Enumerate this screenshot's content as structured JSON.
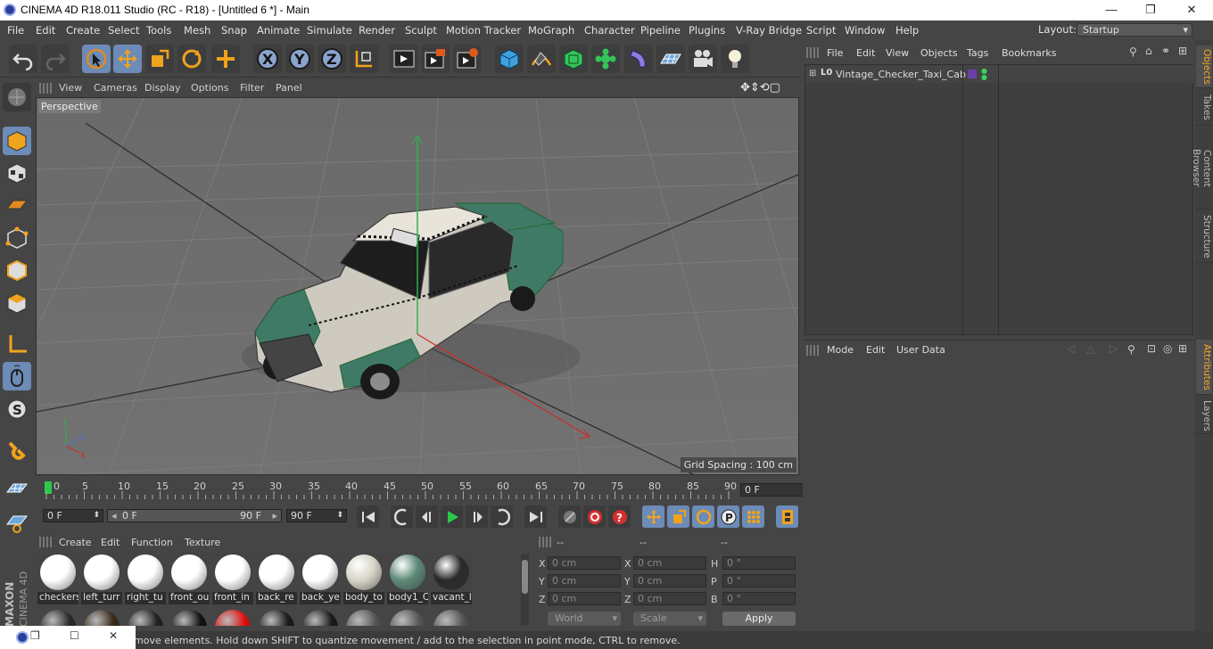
{
  "window": {
    "title": "CINEMA 4D R18.011 Studio (RC - R18) - [Untitled 6 *] - Main",
    "minimize": "—",
    "maximize": "❐",
    "close": "✕"
  },
  "menu": [
    "File",
    "Edit",
    "Create",
    "Select",
    "Tools",
    "Mesh",
    "Snap",
    "Animate",
    "Simulate",
    "Render",
    "Sculpt",
    "Motion Tracker",
    "MoGraph",
    "Character",
    "Pipeline",
    "Plugins",
    "V-Ray Bridge",
    "Script",
    "Window",
    "Help"
  ],
  "layout": {
    "label": "Layout:",
    "value": "Startup"
  },
  "viewport": {
    "menu": [
      "View",
      "Cameras",
      "Display",
      "Options",
      "Filter",
      "Panel"
    ],
    "label": "Perspective",
    "grid_spacing": "Grid Spacing : 100 cm"
  },
  "timeline": {
    "ticks": [
      "0",
      "5",
      "10",
      "15",
      "20",
      "25",
      "30",
      "35",
      "40",
      "45",
      "50",
      "55",
      "60",
      "65",
      "70",
      "75",
      "80",
      "85",
      "90"
    ],
    "current": "0 F"
  },
  "transport": {
    "start": "0 F",
    "range_start": "0 F",
    "range_end": "90 F",
    "end": "90 F"
  },
  "materials": {
    "menu": [
      "Create",
      "Edit",
      "Function",
      "Texture"
    ],
    "items": [
      {
        "name": "checkers",
        "color": "#ffffff"
      },
      {
        "name": "left_turr",
        "color": "#ffffff"
      },
      {
        "name": "right_tu",
        "color": "#ffffff"
      },
      {
        "name": "front_ou",
        "color": "#ffffff"
      },
      {
        "name": "front_in",
        "color": "#ffffff"
      },
      {
        "name": "back_re",
        "color": "#ffffff"
      },
      {
        "name": "back_ye",
        "color": "#ffffff"
      },
      {
        "name": "body_to",
        "color": "#d8d4c8"
      },
      {
        "name": "body1_C",
        "color": "#5e8a78"
      },
      {
        "name": "vacant_l",
        "color": "#2a2a2a"
      }
    ],
    "row2": [
      "#2a2a2a",
      "#3a2a1a",
      "#222222",
      "#111111",
      "#e01010",
      "#1a1a1a",
      "#1a1a1a",
      "#555555",
      "#555555",
      "#555555"
    ]
  },
  "coordinates": {
    "headers": [
      "--",
      "--",
      "--"
    ],
    "pos": {
      "x": "0 cm",
      "y": "0 cm",
      "z": "0 cm"
    },
    "size": {
      "x": "0 cm",
      "y": "0 cm",
      "z": "0 cm"
    },
    "rot": {
      "h": "0 °",
      "p": "0 °",
      "b": "0 °"
    },
    "labels": {
      "x": "X",
      "y": "Y",
      "z": "Z",
      "h": "H",
      "p": "P",
      "b": "B"
    },
    "mode": "World",
    "scale": "Scale",
    "apply": "Apply"
  },
  "objects": {
    "menu": [
      "File",
      "Edit",
      "View",
      "Objects",
      "Tags",
      "Bookmarks"
    ],
    "items": [
      {
        "name": "Vintage_Checker_Taxi_Cab",
        "tag": "L0"
      }
    ]
  },
  "attributes": {
    "menu": [
      "Mode",
      "Edit",
      "User Data"
    ]
  },
  "right_tabs": [
    "Objects",
    "Takes",
    "Content Browser",
    "Structure",
    "Attributes",
    "Layers"
  ],
  "status": "move elements. Hold down SHIFT to quantize movement / add to the selection in point mode, CTRL to remove.",
  "brand": "MAXON CINEMA 4D",
  "colors": {
    "accent": "#6c8bb7",
    "highlight": "#f5a623",
    "taxi_green": "#3f7a66"
  }
}
